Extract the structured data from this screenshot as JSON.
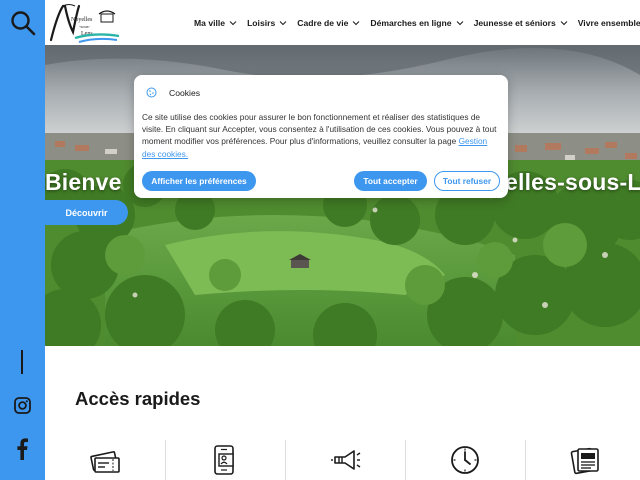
{
  "header": {
    "logo_text": "Noyelles-sous-Lens",
    "nav": [
      {
        "label": "Ma ville"
      },
      {
        "label": "Loisirs"
      },
      {
        "label": "Cadre de vie"
      },
      {
        "label": "Démarches en ligne"
      },
      {
        "label": "Jeunesse et séniors"
      },
      {
        "label": "Vivre ensemble"
      }
    ]
  },
  "rail": {
    "icons": [
      "search-icon",
      "instagram-icon",
      "facebook-icon"
    ]
  },
  "hero": {
    "title_left": "Bienve",
    "title_right": "elles-sous-L",
    "discover_label": "Découvrir"
  },
  "cookie": {
    "title": "Cookies",
    "text": "Ce site utilise des cookies pour assurer le bon fonctionnement et réaliser des statistiques de visite. En cliquant sur Accepter, vous consentez à l'utilisation de ces cookies. Vous pouvez à tout moment modifier vos préférences. Pour plus d'informations, veuillez consulter la page",
    "link_label": "Gestion des cookies.",
    "prefs_label": "Afficher les préférences",
    "accept_label": "Tout accepter",
    "refuse_label": "Tout refuser"
  },
  "quick_access": {
    "title": "Accès rapides",
    "icons": [
      "tickets-icon",
      "id-card-phone-icon",
      "megaphone-icon",
      "clock-icon",
      "documents-icon"
    ]
  },
  "colors": {
    "accent": "#3e97ef",
    "text": "#1a1a1a",
    "white": "#ffffff"
  }
}
